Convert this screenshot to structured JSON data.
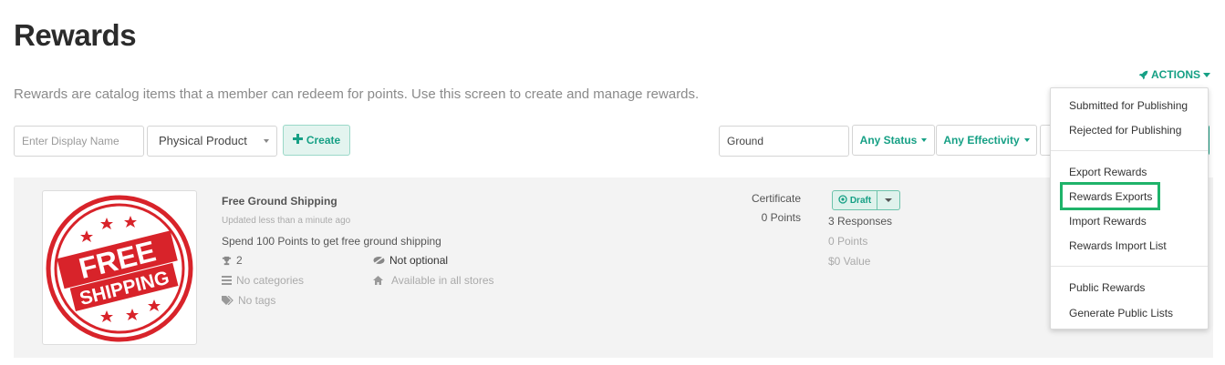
{
  "page": {
    "title": "Rewards",
    "description": "Rewards are catalog items that a member can redeem for points. Use this screen to create and manage rewards.",
    "actions_label": "ACTIONS"
  },
  "toolbar": {
    "display_name_placeholder": "Enter Display Name",
    "type_select_value": "Physical Product",
    "create_label": "Create",
    "search_value": "Ground",
    "status_filter_label": "Any Status",
    "effectivity_filter_label": "Any Effectivity"
  },
  "reward": {
    "title": "Free Ground Shipping",
    "updated": "Updated less than a minute ago",
    "description": "Spend 100 Points to get free ground shipping",
    "count": "2",
    "optional": "Not optional",
    "categories": "No categories",
    "stores": "Available in all stores",
    "tags": "No tags",
    "type": "Certificate",
    "cost": "0 Points",
    "status": "Draft",
    "responses": "3 Responses",
    "points": "0 Points",
    "value": "$0 Value",
    "image": {
      "line1": "FREE",
      "line2": "SHIPPING",
      "color": "#d8232a"
    }
  },
  "actions_menu": {
    "groups": [
      [
        "Submitted for Publishing",
        "Rejected for Publishing"
      ],
      [
        "Export Rewards",
        "Rewards Exports",
        "Import Rewards",
        "Rewards Import List"
      ],
      [
        "Public Rewards",
        "Generate Public Lists"
      ]
    ],
    "highlighted": "Rewards Exports"
  },
  "colors": {
    "accent": "#16a085",
    "highlight_border": "#1fb36a"
  }
}
